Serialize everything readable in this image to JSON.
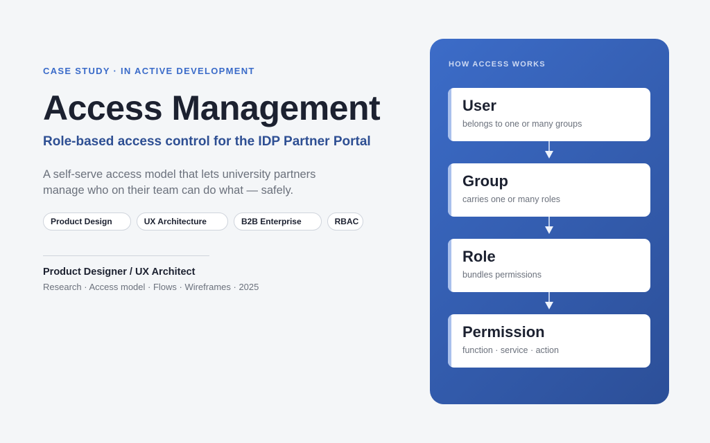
{
  "left": {
    "eyebrow": "CASE STUDY · IN ACTIVE DEVELOPMENT",
    "title": "Access Management",
    "subtitle": "Role-based access control for the IDP Partner Portal",
    "description": "A self-serve access model that lets university partners manage who on their team can do what — safely.",
    "tags": [
      "Product Design",
      "UX Architecture",
      "B2B Enterprise",
      "RBAC"
    ],
    "role": "Product Designer / UX Architect",
    "meta": "Research · Access model · Flows · Wireframes · 2025"
  },
  "panel": {
    "label": "HOW ACCESS WORKS",
    "steps": [
      {
        "title": "User",
        "subtitle": "belongs to one or many groups"
      },
      {
        "title": "Group",
        "subtitle": "carries one or many roles"
      },
      {
        "title": "Role",
        "subtitle": "bundles permissions"
      },
      {
        "title": "Permission",
        "subtitle": "function · service · action"
      }
    ]
  },
  "colors": {
    "accent": "#3a6bc9",
    "subtitle": "#2e4f93",
    "panel_start": "#3c6cc8",
    "panel_end": "#2c4f98",
    "text_dark": "#1c2130",
    "text_muted": "#6b717c"
  }
}
